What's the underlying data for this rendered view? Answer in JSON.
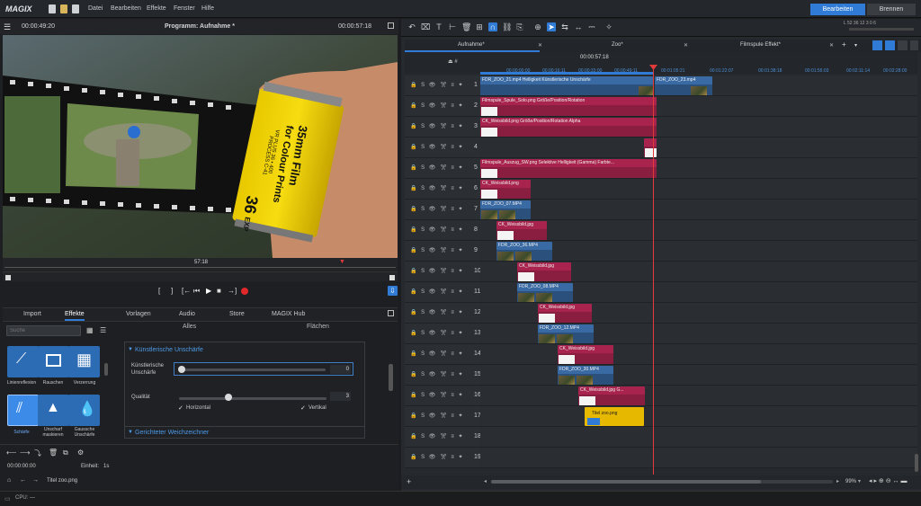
{
  "app": {
    "logo": "MAGIX",
    "menu": [
      "Datei",
      "Bearbeiten",
      "Effekte",
      "Fenster",
      "Hilfe"
    ],
    "mode_buttons": {
      "edit": "Bearbeiten",
      "burn": "Brennen"
    }
  },
  "monitor": {
    "time_left": "00:00:49:20",
    "title": "Programm: Aufnahme *",
    "time_right": "00:00:57:18",
    "scrub_label": "57:18"
  },
  "video_text": {
    "line1": "35mm Film",
    "line2": "for Colour Prints",
    "line3": "VR PLUS 36 • 400",
    "line4": "PROCESS C-41",
    "exp": "36",
    "exp_suffix": "EXP"
  },
  "transport": [
    "[",
    "]",
    "[←",
    "⏮",
    "▶",
    "■",
    "→]"
  ],
  "media_tabs": [
    "Import",
    "Effekte",
    "Vorlagen",
    "Audio",
    "Store",
    "MAGIX Hub"
  ],
  "media_tab_active": "Effekte",
  "search": {
    "placeholder": "Suche"
  },
  "effect_tiles": [
    {
      "label": "Linienreflexion"
    },
    {
      "label": "Rauschen"
    },
    {
      "label": "Verzerrung"
    },
    {
      "label": "Schärfe"
    },
    {
      "label": "Unscharf maskieren"
    },
    {
      "label": "Gaussche Unschärfe"
    }
  ],
  "effect_panel": {
    "top_left": "Alles",
    "top_right": "Flächen",
    "section": "Künstlerische Unschärfe",
    "param1": "Künstlerische Unschärfe",
    "param1_val": "0",
    "quality_label": "Qualität",
    "quality_val": "3",
    "check1": "Horizontal",
    "check2": "Vertikal",
    "section2": "Gerichteter Weichzeichner"
  },
  "bottom_left": {
    "time": "00:00:00:00",
    "unit_label": "Einheit:",
    "unit_value": "1s",
    "file": "Titel zoo.png"
  },
  "status": {
    "cpu": "CPU:",
    "cpu_val": "—"
  },
  "timeline_tabs": [
    "Aufnahme*",
    "Zoo*",
    "Filmspule Effekt*"
  ],
  "timeline_ruler": {
    "current": "00:00:57:18",
    "marks": [
      "00:00:00:00",
      "00:00:16:11",
      "00:00:33:00",
      "00:00:49:11",
      "00:01:05:21",
      "00:01:22:07",
      "00:01:38:18",
      "00:01:55:03",
      "00:02:11:14",
      "00:02:28:00"
    ]
  },
  "vu": {
    "scale": "L 52 36 12 3 0 6"
  },
  "zoom": "99%",
  "tracks": [
    "1",
    "2",
    "3",
    "4",
    "5",
    "6",
    "7",
    "8",
    "9",
    "10",
    "11",
    "12",
    "13",
    "14",
    "15",
    "16",
    "17",
    "18",
    "19"
  ],
  "track_icons": "🔒 S 👁 ✂ ≡ ✦",
  "clips": [
    {
      "track": 1,
      "label": "FDR_ZOO_21.mp4 Helligkeit Künstlerische Unschärfe",
      "color": "blue"
    },
    {
      "track": 1,
      "label": "FDR_ZOO_23.mp4",
      "color": "blue"
    },
    {
      "track": 2,
      "label": "Filmspule_Spule_Solo.png Größe/Position/Rotation",
      "color": "red"
    },
    {
      "track": 3,
      "label": "CK_Weissbild.png Größe/Position/Rotation Alpha",
      "color": "red"
    },
    {
      "track": 4,
      "label": "",
      "color": "red"
    },
    {
      "track": 5,
      "label": "Filmspule_Auszug_SW.png Selektive Helligkeit (Gamma) Farbte...",
      "color": "red"
    },
    {
      "track": 6,
      "label": "CK_Weissbild.png",
      "color": "red"
    },
    {
      "track": 7,
      "label": "FDR_ZOO_07.MP4",
      "color": "blue"
    },
    {
      "track": 8,
      "label": "CK_Weissbild.jpg",
      "color": "red"
    },
    {
      "track": 9,
      "label": "FDR_ZOO_36.MP4",
      "color": "blue"
    },
    {
      "track": 10,
      "label": "CK_Weissbild.jpg",
      "color": "red"
    },
    {
      "track": 11,
      "label": "FDR_ZOO_08.MP4",
      "color": "blue"
    },
    {
      "track": 12,
      "label": "CK_Weissbild.jpg",
      "color": "red"
    },
    {
      "track": 13,
      "label": "FDR_ZOO_12.MP4",
      "color": "blue"
    },
    {
      "track": 14,
      "label": "CK_Weissbild.jpg",
      "color": "red"
    },
    {
      "track": 15,
      "label": "FDR_ZOO_30.MP4",
      "color": "blue"
    },
    {
      "track": 16,
      "label": "CK_Weissbild.jpg G...",
      "color": "red"
    },
    {
      "track": 17,
      "label": "Titel zoo.png",
      "color": "yellow"
    }
  ]
}
